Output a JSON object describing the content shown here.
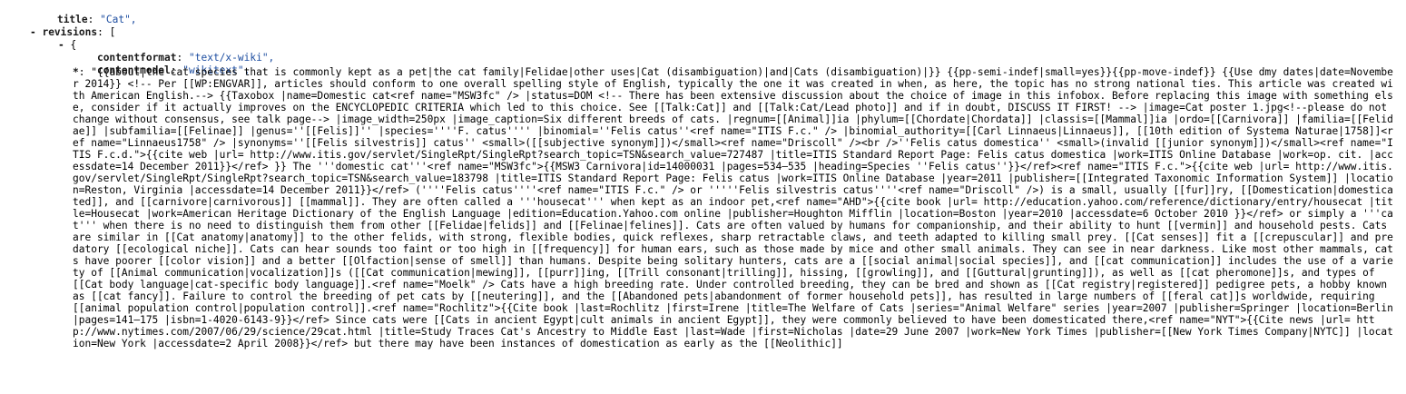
{
  "title_row": {
    "key": "title",
    "value": "\"Cat\","
  },
  "revisions_row": {
    "toggle": "-",
    "key": "revisions",
    "bracket": "["
  },
  "revision_item": {
    "toggle": "-",
    "brace": "{"
  },
  "fields": {
    "contentformat": {
      "key": "contentformat",
      "value": "\"text/x-wiki\","
    },
    "contentmodel": {
      "key": "contentmodel",
      "value": "\"wikitext\","
    }
  },
  "content": {
    "key": "*",
    "value": "\"{{about|the cat species that is commonly kept as a pet|the cat family|Felidae|other uses|Cat (disambiguation)|and|Cats (disambiguation)|}} {{pp-semi-indef|small=yes}}{{pp-move-indef}} {{Use dmy dates|date=November 2014}} <!-- Per [[WP:ENGVAR]], articles should conform to one overall spelling style of English, typically the one it was created in when, as here, the topic has no strong national ties. This article was created with American English.--> {{Taxobox |name=Domestic cat<ref name=\"MSW3fc\" /> |status=DOM <!-- There has been extensive discussion about the choice of image in this infobox. Before replacing this image with something else, consider if it actually improves on the ENCYCLOPEDIC CRITERIA which led to this choice. See [[Talk:Cat]] and [[Talk:Cat/Lead photo]] and if in doubt, DISCUSS IT FIRST! --> |image=Cat poster 1.jpg<!--please do not change without consensus, see talk page--> |image_width=250px |image_caption=Six different breeds of cats. |regnum=[[Animal]]ia |phylum=[[Chordate|Chordata]] |classis=[[Mammal]]ia |ordo=[[Carnivora]] |familia=[[Felidae]] |subfamilia=[[Felinae]] |genus=''[[Felis]]'' |species=''''F. catus'''' |binomial=''Felis catus''<ref name=\"ITIS F.c.\" /> |binomial_authority=[[Carl Linnaeus|Linnaeus]], [[10th edition of Systema Naturae|1758]]<ref name=\"Linnaeus1758\" /> |synonyms=''[[Felis silvestris]] catus'' <small>([[subjective synonym]])</small><ref name=\"Driscoll\" /><br />''Felis catus domestica'' <small>(invalid [[junior synonym]])</small><ref name=\"ITIS F.c.d.\">{{cite web |url= http://www.itis.gov/servlet/SingleRpt/SingleRpt?search_topic=TSN&search_value=727487 |title=ITIS Standard Report Page: Felis catus domestica |work=ITIS Online Database |work=op. cit. |accessdate=14 December 2011}}</ref> }} The '''domestic cat'''<ref name=\"MSW3fc\">{{MSW3 Carnivora|id=14000031 |pages=534–535 |heading=Species ''Felis catus''}}</ref><ref name=\"ITIS F.c.\">{{cite web |url= http://www.itis.gov/servlet/SingleRpt/SingleRpt?search_topic=TSN&search_value=183798 |title=ITIS Standard Report Page: Felis catus |work=ITIS Online Database |year=2011 |publisher=[[Integrated Taxonomic Information System]] |location=Reston, Virginia |accessdate=14 December 2011}}</ref> (''''Felis catus''''<ref name=\"ITIS F.c.\" /> or '''''Felis silvestris catus''''<ref name=\"Driscoll\" />) is a small, usually [[fur]]ry, [[Domestication|domesticated]], and [[carnivore|carnivorous]] [[mammal]]. They are often called a '''housecat''' when kept as an indoor pet,<ref name=\"AHD\">{{cite book |url= http://education.yahoo.com/reference/dictionary/entry/housecat |title=Housecat |work=American Heritage Dictionary of the English Language |edition=Education.Yahoo.com online |publisher=Houghton Mifflin |location=Boston |year=2010 |accessdate=6 October 2010 }}</ref> or simply a '''cat''' when there is no need to distinguish them from other [[Felidae|felids]] and [[Felinae|felines]]. Cats are often valued by humans for companionship, and their ability to hunt [[vermin]] and household pests. Cats are similar in [[Cat anatomy|anatomy]] to the other felids, with strong, flexible bodies, quick reflexes, sharp retractable claws, and teeth adapted to killing small prey. [[Cat senses]] fit a [[crepuscular]] and predatory [[ecological niche]]. Cats can hear sounds too faint or too high in [[frequency]] for human ears, such as those made by mice and other small animals. They can see in near darkness. Like most other mammals, cats have poorer [[color vision]] and a better [[Olfaction|sense of smell]] than humans. Despite being solitary hunters, cats are a [[social animal|social species]], and [[cat communication]] includes the use of a variety of [[Animal communication|vocalization]]s ([[Cat communication|mewing]], [[purr]]ing, [[Trill consonant|trilling]], hissing, [[growling]], and [[Guttural|grunting]]), as well as [[cat pheromone]]s, and types of [[Cat body language|cat-specific body language]].<ref name=\"Moelk\" /> Cats have a high breeding rate. Under controlled breeding, they can be bred and shown as [[Cat registry|registered]] pedigree pets, a hobby known as [[cat fancy]]. Failure to control the breeding of pet cats by [[neutering]], and the [[Abandoned pets|abandonment of former household pets]], has resulted in large numbers of [[feral cat]]s worldwide, requiring [[animal population control|population control]].<ref name=\"Rochlitz\">{{Cite book |last=Rochlitz |first=Irene |title=The Welfare of Cats |series=\"Animal Welfare\" series |year=2007 |publisher=Springer |location=Berlin |pages=141–175 |isbn=1-4020-6143-9}}</ref> Since cats were [[Cats in ancient Egypt|cult animals in ancient Egypt]], they were commonly believed to have been domesticated there,<ref name=\"NYT\">{{Cite news |url= http://www.nytimes.com/2007/06/29/science/29cat.html |title=Study Traces Cat's Ancestry to Middle East |last=Wade |first=Nicholas |date=29 June 2007 |work=New York Times |publisher=[[New York Times Company|NYTC]] |location=New York |accessdate=2 April 2008}}</ref> but there may have been instances of domestication as early as the [[Neolithic]]"
  }
}
